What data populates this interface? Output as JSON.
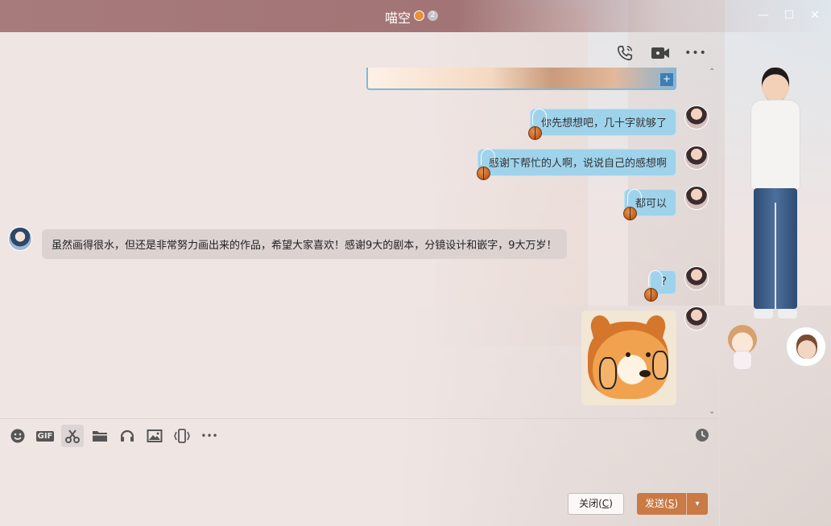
{
  "window": {
    "title": "喵空",
    "badge_level": "2",
    "controls": {
      "minimize": "—",
      "maximize": "☐",
      "close": "✕"
    }
  },
  "top_tools": {
    "icons": [
      "phone-icon",
      "video-icon",
      "more-icon"
    ],
    "more_label": "•••"
  },
  "chat": {
    "scroll_up": "⌃",
    "scroll_down": "⌄",
    "image_zoom": "+",
    "messages": [
      {
        "side": "right",
        "text": "你先想想吧，几十字就够了"
      },
      {
        "side": "right",
        "text": "感谢下帮忙的人啊，说说自己的感想啊"
      },
      {
        "side": "right",
        "text": "都可以"
      },
      {
        "side": "left",
        "text": "虽然画得很水，但还是非常努力画出来的作品，希望大家喜欢！感谢9大的剧本，分镜设计和嵌字，9大万岁！"
      },
      {
        "side": "right",
        "text": "?"
      }
    ]
  },
  "input_tools": {
    "gif_label": "GIF",
    "more_label": "•••"
  },
  "buttons": {
    "close_label": "关闭(",
    "close_key": "C",
    "close_end": ")",
    "send_label": "发送(",
    "send_key": "S",
    "send_end": ")",
    "send_arrow": "▾"
  },
  "colors": {
    "titlebar": "#a77a7b",
    "bubble_self": "#9fd3ec",
    "bubble_other": "#dcd3d1",
    "send_button": "#c97a45"
  }
}
